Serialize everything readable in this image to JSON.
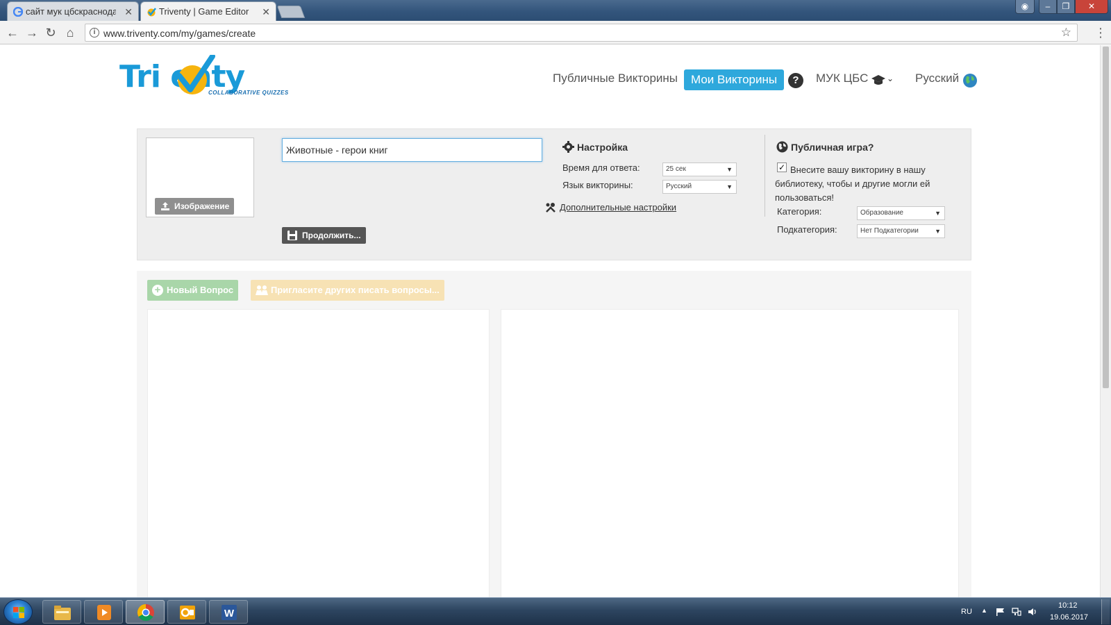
{
  "browser": {
    "tabs": [
      {
        "title": "сайт мук цбскраснодар",
        "favicon": "google-icon",
        "active": false
      },
      {
        "title": "Triventy | Game Editor",
        "favicon": "triventy-icon",
        "active": true
      }
    ],
    "url": "www.triventy.com/my/games/create"
  },
  "site": {
    "logo_text": "Tri enty",
    "logo_tagline": "COLLABORATIVE QUIZZES",
    "nav": {
      "public_quizzes": "Публичные Викторины",
      "my_quizzes": "Мои Викторины",
      "help": "?",
      "organization": "МУК ЦБС",
      "language": "Русский"
    }
  },
  "editor": {
    "image_button": "Изображение",
    "title_value": "Животные - герои книг",
    "continue_button": "Продолжить...",
    "settings": {
      "title": "Настройка",
      "answer_time_label": "Время для ответа:",
      "answer_time_value": "25 сек",
      "quiz_language_label": "Язык викторины:",
      "quiz_language_value": "Русский",
      "advanced_link": "Дополнительные настройки"
    },
    "public": {
      "title": "Публичная игра?",
      "checked": true,
      "description": "Внесите вашу викторину в нашу библиотеку, чтобы и другие могли ей пользоваться!",
      "category_label": "Категория:",
      "category_value": "Образование",
      "subcategory_label": "Подкатегория:",
      "subcategory_value": "Нет Подкатегории"
    }
  },
  "questions": {
    "new_question_button": "Новый Вопрос",
    "invite_button": "Пригласите других писать вопросы..."
  },
  "taskbar": {
    "apps": [
      "explorer-icon",
      "media-player-icon",
      "chrome-icon",
      "outlook-icon",
      "word-icon"
    ],
    "language": "RU",
    "time": "10:12",
    "date": "19.06.2017"
  },
  "colors": {
    "brand_blue": "#1a9ad8",
    "brand_yellow": "#f6b40e",
    "nav_active": "#2ea8dc",
    "new_question": "#a9d6a9",
    "invite": "#f7e2b4"
  }
}
